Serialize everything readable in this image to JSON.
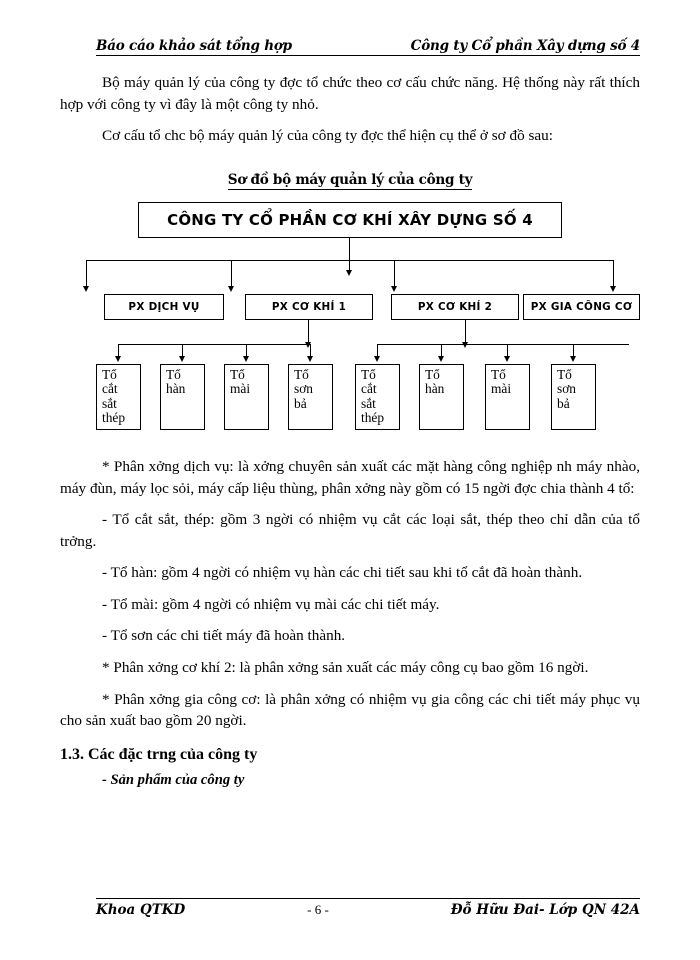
{
  "header": {
    "left": "Báo cáo khảo sát tổng hợp",
    "right": "Công ty Cổ phần Xây dựng số 4"
  },
  "body": {
    "para1": "Bộ máy quản lý của công ty đợc  tổ chức theo cơ cấu chức năng. Hệ thống này rất thích hợp với công ty vì đây là một công ty nhỏ.",
    "para2": "Cơ cấu tổ chc  bộ máy quản lý của công ty đợc  thể hiện cụ thể ở sơ đồ sau:",
    "para3": "* Phân xởng  dịch vụ: là xởng  chuyên sản xuất các mặt hàng công nghiệp nh  máy nhào, máy đùn, máy lọc sỏi, máy cấp liệu thùng, phân xởng này gồm có 15 ngời  đợc  chia thành 4 tổ:",
    "para4": "- Tổ cắt sắt, thép: gồm 3 ngời  có nhiệm vụ cắt các loại sắt, thép theo chỉ dẫn của tổ trởng.",
    "para5": "- Tổ hàn: gồm 4 ngời  có nhiệm vụ hàn các chi tiết sau khi tổ cắt đã hoàn thành.",
    "para6": "- Tổ mài: gồm 4 ngời  có nhiệm vụ mài các chi tiết máy.",
    "para7": "- Tổ sơn các chi tiết máy đã hoàn thành.",
    "para8": "* Phân xởng  cơ khí 2: là phân xởng  sản xuất các máy công cụ bao gồm 16 ngời.",
    "para9": "* Phân xởng  gia công cơ: là phân xởng  có nhiệm vụ gia công các chi tiết máy phục vụ cho sản xuất bao gồm 20 ngời.",
    "section_heading": "1.3. Các đặc trng  của công ty",
    "sub_bullet": "- Sản phẩm của công ty"
  },
  "diagram": {
    "title": "Sơ đồ bộ máy quản lý của công ty",
    "root": "CÔNG TY CỔ PHẦN CƠ KHÍ XÂY DỰNG SỐ 4",
    "level2": [
      {
        "label": "PX  DỊCH VỤ"
      },
      {
        "label": "PX CƠ KHÍ 1"
      },
      {
        "label": "PX CƠ KHÍ 2"
      },
      {
        "label": "PX GIA CÔNG CƠ"
      }
    ],
    "leaves_left": [
      {
        "label": "Tổ\ncắt\nsắt\nthép"
      },
      {
        "label": "Tổ\nhàn"
      },
      {
        "label": "Tổ\nmài"
      },
      {
        "label": "Tổ\nsơn\nbả"
      }
    ],
    "leaves_right": [
      {
        "label": "Tổ\ncắt\nsắt\nthép"
      },
      {
        "label": "Tổ\nhàn"
      },
      {
        "label": "Tổ\nmài"
      },
      {
        "label": "Tổ\nsơn\nbả"
      }
    ]
  },
  "footer": {
    "left": "Khoa QTKD",
    "center": "- 6 -",
    "right": "Đỗ Hữu Đai- Lớp QN 42A"
  },
  "colors": {
    "ink": "#000000",
    "paper": "#ffffff"
  }
}
